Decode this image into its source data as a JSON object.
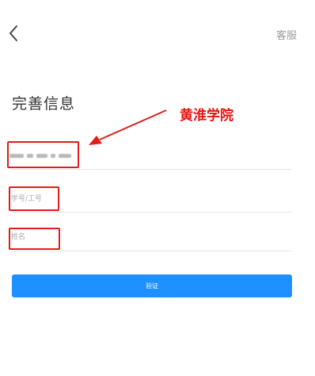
{
  "header": {
    "back_icon": "chevron-left-icon",
    "service_label": "客服"
  },
  "title": "完善信息",
  "annotation": {
    "text": "黄淮学院",
    "color": "#e8140f"
  },
  "form": {
    "school_value": "",
    "student_id_placeholder": "学号/工号",
    "name_placeholder": "姓名"
  },
  "verify_button": {
    "label": "验证",
    "color": "#1e90ff"
  }
}
